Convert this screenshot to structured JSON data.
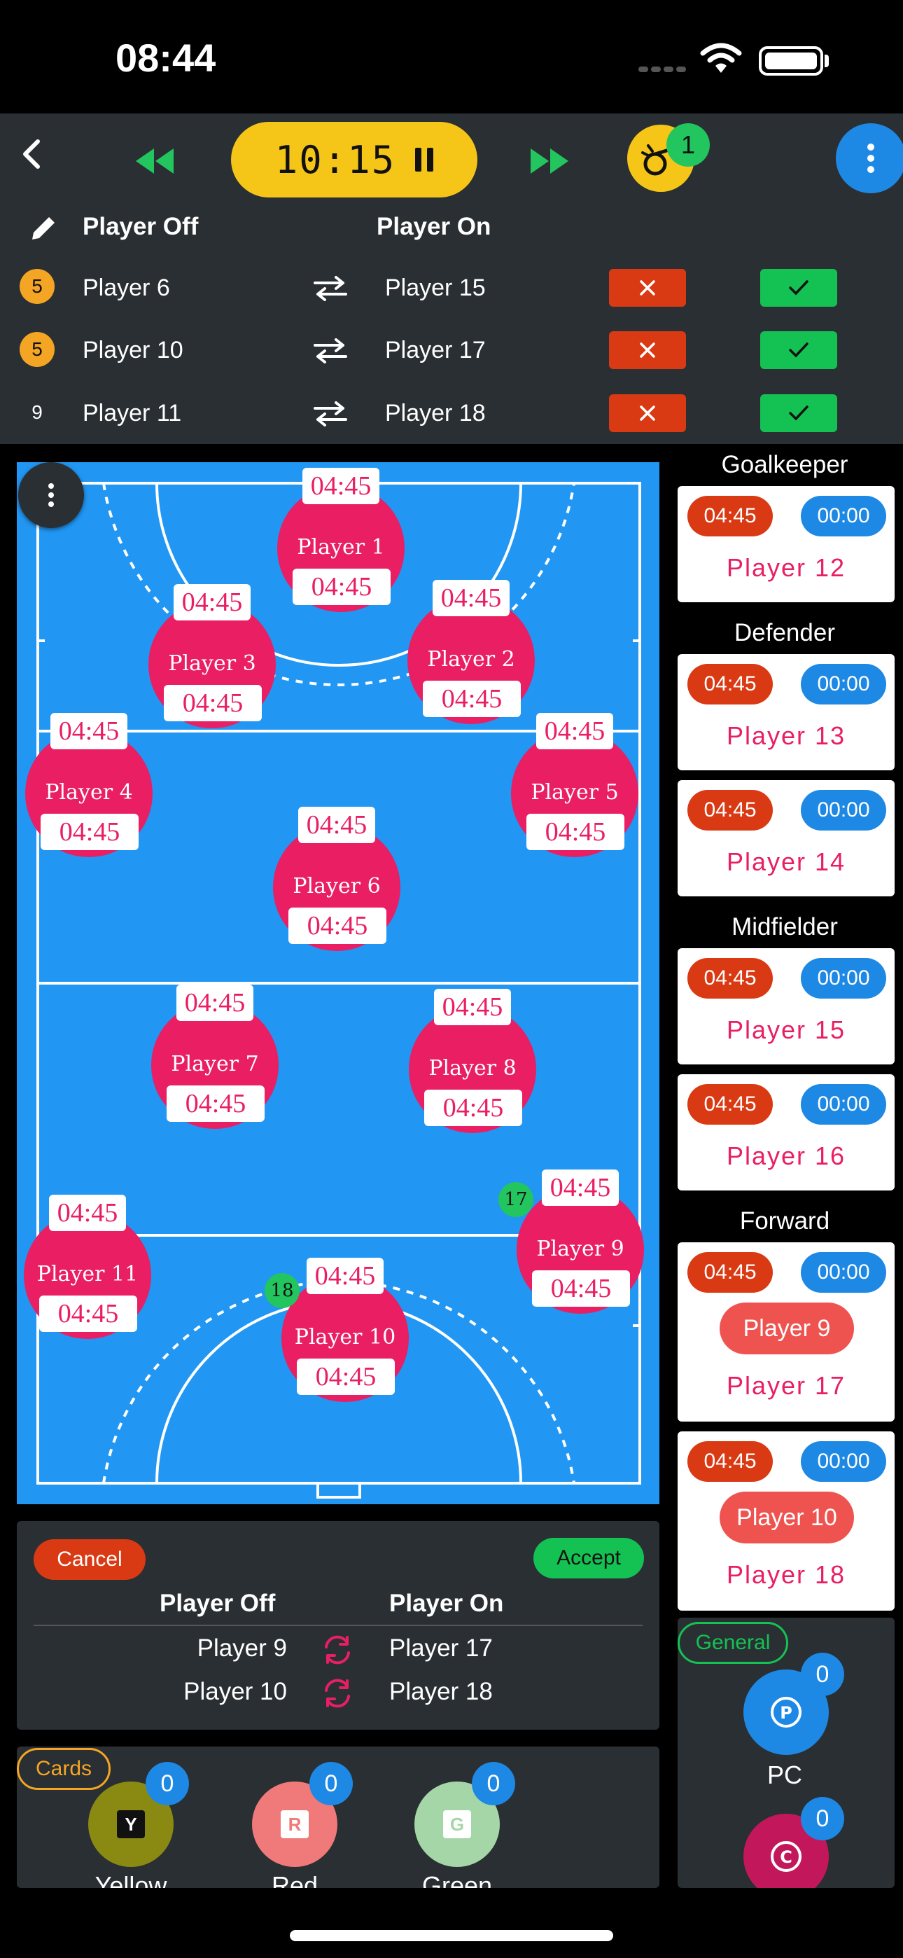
{
  "status_bar": {
    "time": "08:44"
  },
  "toolbar": {
    "timer": "10:15",
    "sub_count": "1"
  },
  "sub_list": {
    "header_off": "Player Off",
    "header_on": "Player On",
    "rows": [
      {
        "num": "5",
        "off": "Player 6",
        "on": "Player 15",
        "num_color": "#f5a524"
      },
      {
        "num": "5",
        "off": "Player 10",
        "on": "Player 17",
        "num_color": "#f5a524"
      },
      {
        "num": "9",
        "off": "Player 11",
        "on": "Player 18",
        "num_color": ""
      }
    ]
  },
  "pitch_players": [
    {
      "name": "Player 1",
      "top": "04:45",
      "bottom": "04:45"
    },
    {
      "name": "Player 3",
      "top": "04:45",
      "bottom": "04:45"
    },
    {
      "name": "Player 2",
      "top": "04:45",
      "bottom": "04:45"
    },
    {
      "name": "Player 4",
      "top": "04:45",
      "bottom": "04:45"
    },
    {
      "name": "Player 5",
      "top": "04:45",
      "bottom": "04:45"
    },
    {
      "name": "Player 6",
      "top": "04:45",
      "bottom": "04:45"
    },
    {
      "name": "Player 7",
      "top": "04:45",
      "bottom": "04:45"
    },
    {
      "name": "Player 8",
      "top": "04:45",
      "bottom": "04:45"
    },
    {
      "name": "Player 11",
      "top": "04:45",
      "bottom": "04:45"
    },
    {
      "name": "Player 9",
      "top": "04:45",
      "bottom": "04:45",
      "jersey": "17"
    },
    {
      "name": "Player 10",
      "top": "04:45",
      "bottom": "04:45",
      "jersey": "18"
    }
  ],
  "roster": {
    "goalkeeper": "Goalkeeper",
    "defender": "Defender",
    "midfielder": "Midfielder",
    "forward": "Forward",
    "cards": [
      {
        "t1": "04:45",
        "t2": "00:00",
        "name": "Player 12"
      },
      {
        "t1": "04:45",
        "t2": "00:00",
        "name": "Player 13"
      },
      {
        "t1": "04:45",
        "t2": "00:00",
        "name": "Player 14"
      },
      {
        "t1": "04:45",
        "t2": "00:00",
        "name": "Player 15"
      },
      {
        "t1": "04:45",
        "t2": "00:00",
        "name": "Player 16"
      },
      {
        "t1": "04:45",
        "t2": "00:00",
        "off": "Player 9",
        "name": "Player 17"
      },
      {
        "t1": "04:45",
        "t2": "00:00",
        "off": "Player 10",
        "name": "Player 18"
      }
    ]
  },
  "confirm": {
    "cancel": "Cancel",
    "accept": "Accept",
    "header_off": "Player Off",
    "header_on": "Player On",
    "rows": [
      {
        "off": "Player 9",
        "on": "Player 17"
      },
      {
        "off": "Player 10",
        "on": "Player 18"
      }
    ]
  },
  "cards_panel": {
    "chip": "Cards",
    "yellow": {
      "letter": "Y",
      "count": "0",
      "label": "Yellow"
    },
    "red": {
      "letter": "R",
      "count": "0",
      "label": "Red"
    },
    "green": {
      "letter": "G",
      "count": "0",
      "label": "Green"
    }
  },
  "general_panel": {
    "chip": "General",
    "pc": {
      "letter": "P",
      "count": "0",
      "label": "PC"
    },
    "c": {
      "letter": "C",
      "count": "0"
    }
  },
  "colors": {
    "accent_yellow": "#f5c518",
    "pitch_blue": "#2196f3",
    "player_pink": "#e91e63",
    "cancel_red": "#d93a13",
    "accept_green": "#14c253",
    "panel": "#2a2f33"
  }
}
